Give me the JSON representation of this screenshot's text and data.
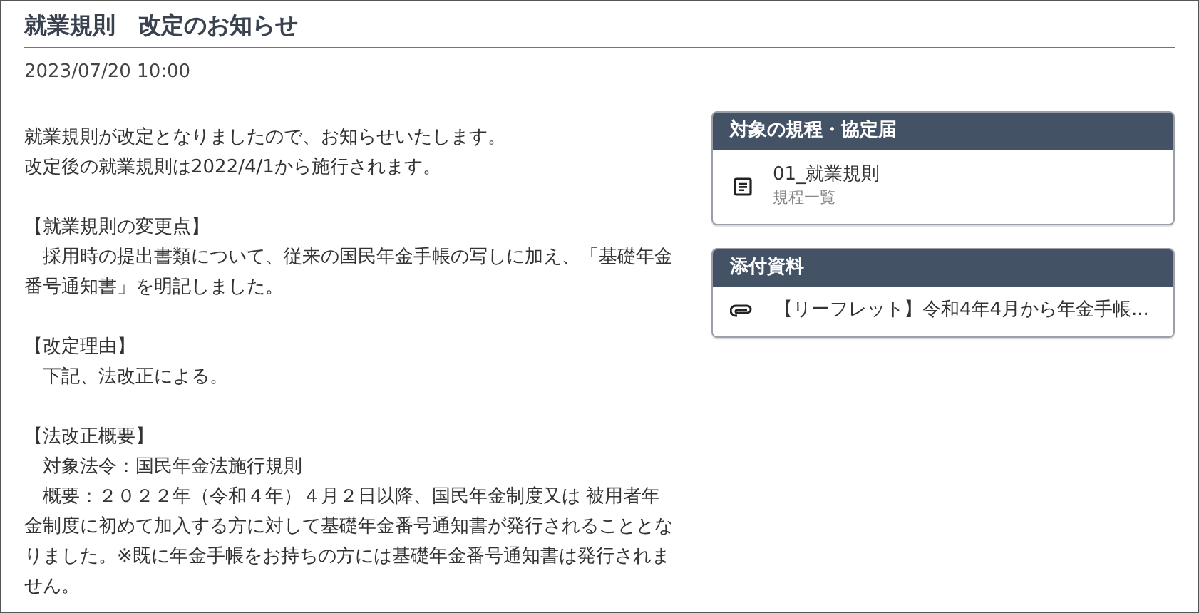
{
  "title": "就業規則　改定のお知らせ",
  "date": "2023/07/20 10:00",
  "body": [
    [
      "就業規則が改定となりましたので、お知らせいたします。",
      "改定後の就業規則は2022/4/1から施行されます。"
    ],
    [
      "【就業規則の変更点】",
      "　採用時の提出書類について、従来の国民年金手帳の写しに加え、「基礎年金番号通知書」を明記しました。"
    ],
    [
      "【改定理由】",
      "　下記、法改正による。"
    ],
    [
      "【法改正概要】",
      "　対象法令：国民年金法施行規則",
      "　概要：２０２２年（令和４年）４月２日以降、国民年金制度又は 被用者年金制度に初めて加入する方に対して基礎年金番号通知書が発行されることとなりました。※既に年金手帳をお持ちの方には基礎年金番号通知書は発行されません。"
    ]
  ],
  "cards": [
    {
      "header": "対象の規程・協定届",
      "items": [
        {
          "kind": "document",
          "title": "01_就業規則",
          "subtitle": "規程一覧"
        }
      ]
    },
    {
      "header": "添付資料",
      "items": [
        {
          "kind": "attachment",
          "title": "【リーフレット】令和4年4月から年金手帳..."
        }
      ]
    }
  ]
}
